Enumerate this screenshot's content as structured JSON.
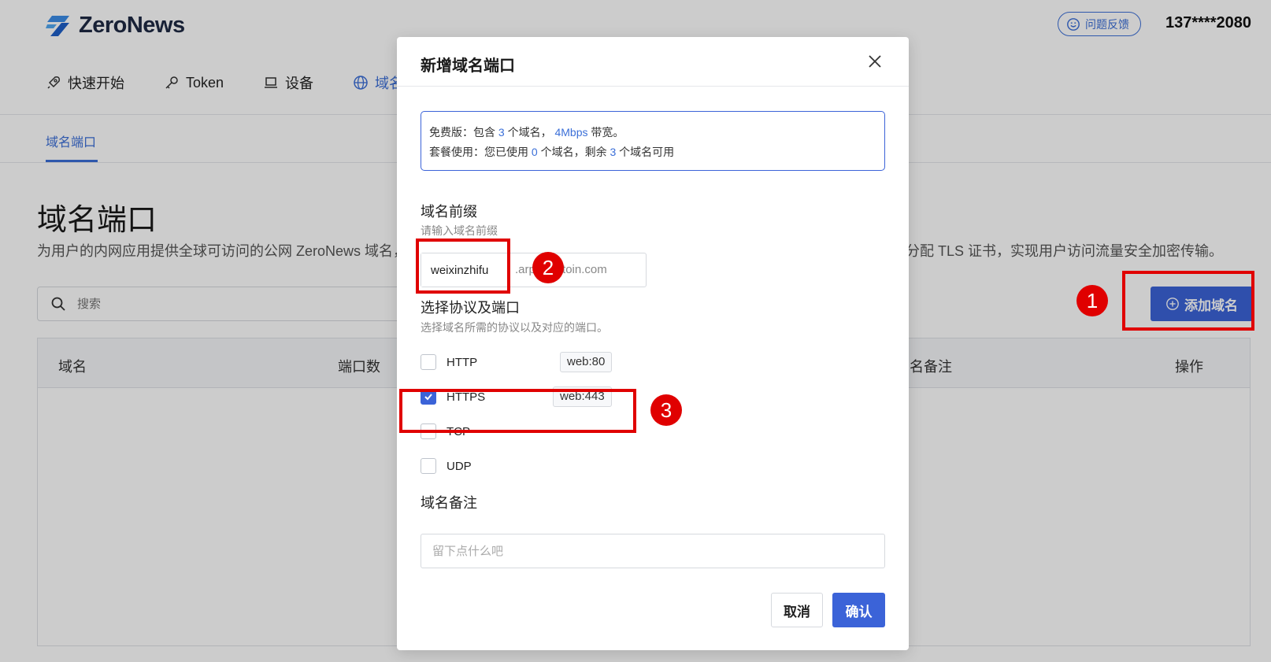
{
  "header": {
    "brand": "ZeroNews",
    "feedback_label": "问题反馈",
    "user_phone": "137****2080"
  },
  "nav": {
    "items": [
      {
        "label": "快速开始",
        "icon": "rocket-icon"
      },
      {
        "label": "Token",
        "icon": "key-icon"
      },
      {
        "label": "设备",
        "icon": "laptop-icon"
      },
      {
        "label": "域名",
        "icon": "globe-icon"
      }
    ]
  },
  "subnav": {
    "tab": "域名端口"
  },
  "page": {
    "title": "域名端口",
    "desc_left": "为用户的内网应用提供全球可访问的公网 ZeroNews 域名，",
    "desc_right": "分配 TLS 证书，实现用户访问流量安全加密传输。",
    "search_placeholder": "搜索",
    "add_button": "添加域名",
    "table_headers": [
      "域名",
      "端口数",
      "名备注",
      "操作"
    ]
  },
  "modal": {
    "title": "新增域名端口",
    "info": {
      "line1_a": "免费版：包含 ",
      "line1_domains": "3",
      "line1_b": " 个域名， ",
      "line1_bw": "4Mbps",
      "line1_c": " 带宽。",
      "line2_a": "套餐使用：您已使用 ",
      "line2_used": "0",
      "line2_b": " 个域名，剩余 ",
      "line2_left": "3",
      "line2_c": " 个域名可用"
    },
    "prefix_label": "域名前缀",
    "prefix_hint": "请输入域名前缀",
    "prefix_value": "weixinzhifu",
    "prefix_suffix": ".arpc.waitoin.com",
    "protocol_label": "选择协议及端口",
    "protocol_hint": "选择域名所需的协议以及对应的端口。",
    "protocols": [
      {
        "name": "HTTP",
        "port": "web:80",
        "checked": false
      },
      {
        "name": "HTTPS",
        "port": "web:443",
        "checked": true
      },
      {
        "name": "TCP",
        "port": "",
        "checked": false
      },
      {
        "name": "UDP",
        "port": "",
        "checked": false
      }
    ],
    "note_label": "域名备注",
    "note_placeholder": "留下点什么吧",
    "cancel_label": "取消",
    "confirm_label": "确认"
  },
  "annotations": [
    "1",
    "2",
    "3"
  ],
  "colors": {
    "accent": "#3b63d8",
    "annotation": "#e00000"
  }
}
